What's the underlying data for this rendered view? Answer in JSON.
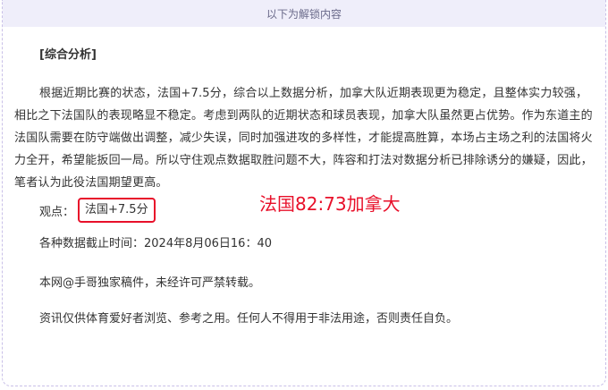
{
  "unlock": {
    "header_text": "以下为解锁内容"
  },
  "analysis": {
    "heading": "[综合分析]",
    "paragraph": "根据近期比赛的状态，法国+7.5分，综合以上数据分析，加拿大队近期表现更为稳定，且整体实力较强，相比之下法国队的表现略显不稳定。考虑到两队的近期状态和球员表现，加拿大队虽然更占优势。作为东道主的法国队需要在防守端做出调整，减少失误，同时加强进攻的多样性，才能提高胜算，本场占主场之利的法国将火力全开，希望能扳回一局。所以守住观点数据取胜问题不大，阵容和打法对数据分析已排除诱分的嫌疑，因此，笔者认为此役法国期望更高。",
    "view_label": "观点：",
    "view_pick": "法国+7.5分",
    "score_text": "法国82:73加拿大",
    "deadline": "各种数据截止时间：2024年8月06日16：40",
    "copyright": "本网@手哥独家稿件，未经许可严禁转载。",
    "disclaimer": "资讯仅供体育爱好者浏览、参考之用。任何人不得用于非法用途，否则责任自负。"
  },
  "colors": {
    "header_bg": "#efeefa",
    "highlight_red": "#e8102a",
    "dashed_border": "#c9c0e8"
  }
}
